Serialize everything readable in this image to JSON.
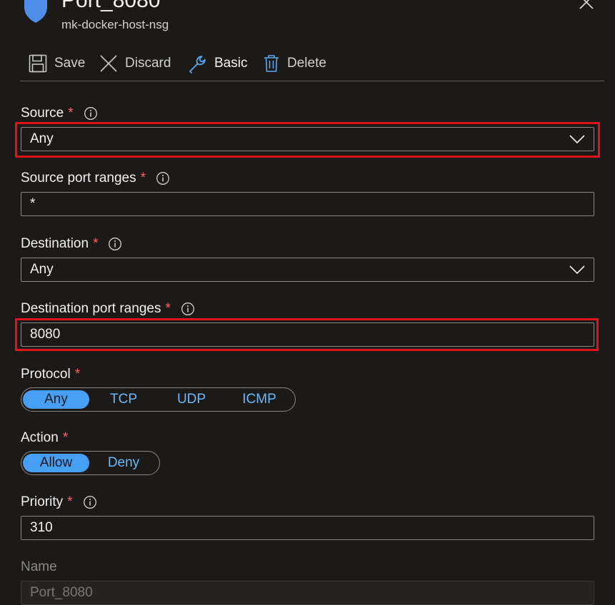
{
  "header": {
    "title": "Port_8080",
    "subtitle": "mk-docker-host-nsg"
  },
  "toolbar": {
    "save": "Save",
    "discard": "Discard",
    "basic": "Basic",
    "delete": "Delete"
  },
  "form": {
    "source": {
      "label": "Source",
      "required": "*",
      "value": "Any"
    },
    "source_port_ranges": {
      "label": "Source port ranges",
      "required": "*",
      "value": "*"
    },
    "destination": {
      "label": "Destination",
      "required": "*",
      "value": "Any"
    },
    "destination_port_ranges": {
      "label": "Destination port ranges",
      "required": "*",
      "value": "8080"
    },
    "protocol": {
      "label": "Protocol",
      "required": "*",
      "options": [
        "Any",
        "TCP",
        "UDP",
        "ICMP"
      ],
      "selected": "Any"
    },
    "action": {
      "label": "Action",
      "required": "*",
      "options": [
        "Allow",
        "Deny"
      ],
      "selected": "Allow"
    },
    "priority": {
      "label": "Priority",
      "required": "*",
      "value": "310"
    },
    "name": {
      "label": "Name",
      "value": "Port_8080"
    }
  },
  "colors": {
    "background": "#1b1a19",
    "accent": "#479ef5",
    "required": "#ff5f5f",
    "highlight": "#e0141e"
  }
}
